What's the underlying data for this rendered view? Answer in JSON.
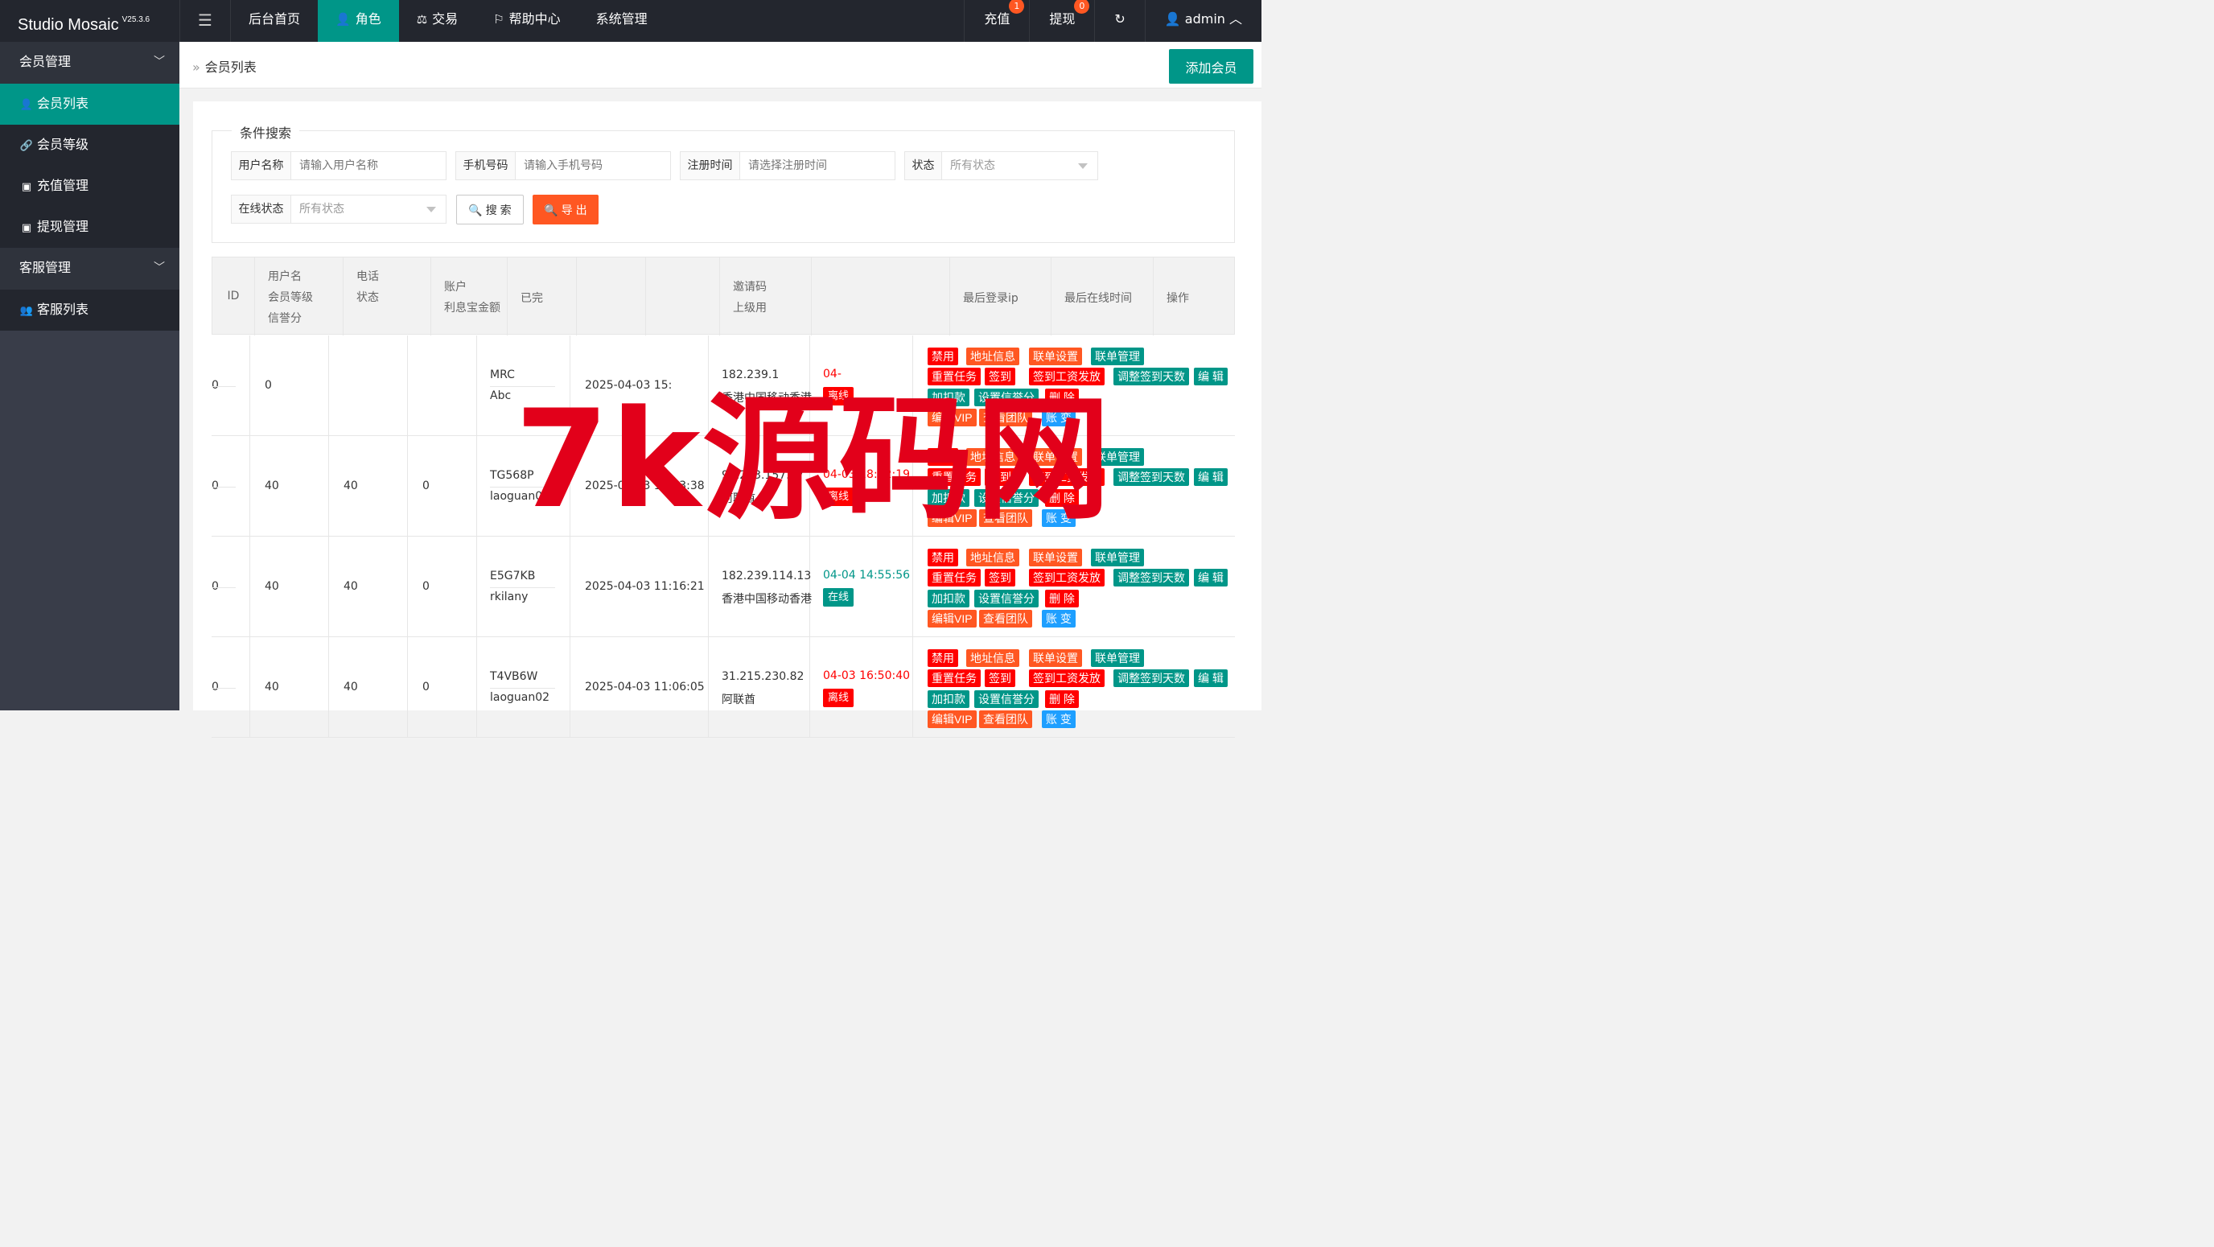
{
  "app": {
    "title": "Studio Mosaic",
    "version": "V25.3.6"
  },
  "topnav": [
    {
      "label": "后台首页",
      "icon": ""
    },
    {
      "label": "角色",
      "icon": "user-icon"
    },
    {
      "label": "交易",
      "icon": "scale-icon"
    },
    {
      "label": "帮助中心",
      "icon": "flag-icon"
    },
    {
      "label": "系统管理",
      "icon": ""
    }
  ],
  "topright": {
    "recharge": {
      "label": "充值",
      "badge": "1"
    },
    "withdraw": {
      "label": "提现",
      "badge": "0"
    },
    "user": "admin"
  },
  "sidebar": {
    "member_group": "会员管理",
    "items": [
      "会员列表",
      "会员等级",
      "充值管理",
      "提现管理"
    ],
    "service_group": "客服管理",
    "service_items": [
      "客服列表"
    ]
  },
  "breadcrumb": "会员列表",
  "add_button": "添加会员",
  "search": {
    "legend": "条件搜索",
    "username": {
      "label": "用户名称",
      "placeholder": "请输入用户名称"
    },
    "phone": {
      "label": "手机号码",
      "placeholder": "请输入手机号码"
    },
    "regtime": {
      "label": "注册时间",
      "placeholder": "请选择注册时间"
    },
    "status": {
      "label": "状态",
      "value": "所有状态"
    },
    "online": {
      "label": "在线状态",
      "value": "所有状态"
    },
    "search_btn": "搜 索",
    "export_btn": "导 出"
  },
  "table": {
    "headers": {
      "id": "ID",
      "user1": "用户名",
      "user2": "会员等级",
      "user3": "信誉分",
      "phone1": "电话",
      "phone2": "状态",
      "acct1": "账户",
      "acct2": "利息宝金额",
      "done": "已完",
      "invite1": "邀请码",
      "invite2": "上级用",
      "lastip": "最后登录ip",
      "lastonline": "最后在线时间",
      "ops": "操作"
    },
    "rows": [
      {
        "id": "0",
        "c1": "0",
        "c2": "",
        "c3": "",
        "name1": "MRC",
        "name2": "Abc",
        "regtime": "2025-04-03 15:",
        "ip": "182.239.1",
        "loc": "香港中国移动香港",
        "time": "04-",
        "status": "离线"
      },
      {
        "id": "0",
        "c1": "40",
        "c2": "40",
        "c3": "0",
        "name1": "TG568P",
        "name2": "laoguan02",
        "regtime": "2025-04-03 15:43:38",
        "ip": "94.203.157.47",
        "loc": "阿联酋",
        "time": "04-03 18:42:19",
        "status": "离线"
      },
      {
        "id": "0",
        "c1": "40",
        "c2": "40",
        "c3": "0",
        "name1": "E5G7KB",
        "name2": "rkilany",
        "regtime": "2025-04-03 11:16:21",
        "ip": "182.239.114.13",
        "loc": "香港中国移动香港",
        "time": "04-04 14:55:56",
        "status": "在线"
      },
      {
        "id": "0",
        "c1": "40",
        "c2": "40",
        "c3": "0",
        "name1": "T4VB6W",
        "name2": "laoguan02",
        "regtime": "2025-04-03 11:06:05",
        "ip": "31.215.230.82",
        "loc": "阿联酋",
        "time": "04-03 16:50:40",
        "status": "离线"
      }
    ],
    "actions": {
      "ban": "禁用",
      "address": "地址信息",
      "order_set": "联单设置",
      "order_mgr": "联单管理",
      "reset_task": "重置任务",
      "sign": "签到",
      "sign_pay": "签到工资发放",
      "adjust_days": "调整签到天数",
      "edit": "编 辑",
      "deduct": "加扣款",
      "credit": "设置信誉分",
      "delete": "删 除",
      "vip": "编辑VIP",
      "team": "查看团队",
      "account": "账 变"
    }
  },
  "watermark": "7k源码网",
  "colors": {
    "accent": "#009688",
    "topbar": "#23262e",
    "sidebar": "#393d49",
    "danger": "#ff0000",
    "warn": "#ff5722",
    "info": "#1e9fff"
  }
}
